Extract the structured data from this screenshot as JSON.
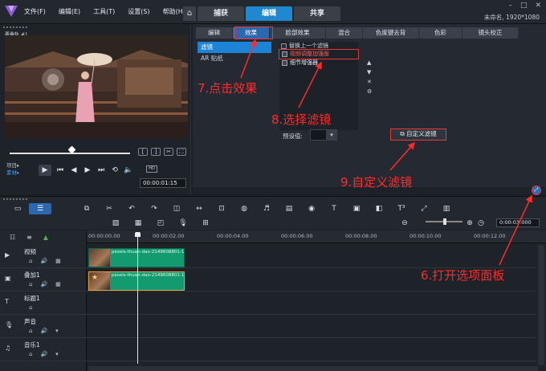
{
  "menu": {
    "items": [
      "文件(F)",
      "编辑(E)",
      "工具(T)",
      "设置(S)",
      "帮助(H)"
    ],
    "modes": [
      "捕获",
      "编辑",
      "共享"
    ],
    "active_mode": "编辑",
    "project_info": "未命名, 1920*1080"
  },
  "preview": {
    "clip_label": "覆叠轨 #1",
    "mode_project": "项目▸",
    "mode_clip": "素材▸",
    "timecode": "00:00:01:15"
  },
  "library": {
    "tabs": [
      "编辑",
      "效果",
      "脸部效果",
      "混合",
      "色度键去背",
      "色彩",
      "镜头校正"
    ],
    "active_tab": "效果",
    "categories": [
      "滤镜",
      "AR 贴纸"
    ],
    "active_category": "滤镜",
    "replace_last_filter": "替换上一个滤镜",
    "filters": [
      "视频调整加强版",
      "细节增强器"
    ],
    "selected_filter": "视频调整加强版",
    "preset_label": "预设值:",
    "custom_filter_button": "自定义滤镜"
  },
  "annotations": {
    "step6": "6.打开选项面板",
    "step7": "7.点击效果",
    "step8": "8.选择滤镜",
    "step9": "9.自定义滤镜"
  },
  "timeline": {
    "timecode": "0:00:03:000",
    "ruler": [
      "00:00:00.00",
      "00:00:02.00",
      "00:00:04.00",
      "00:00:06.00",
      "00:00:08.00",
      "00:00:10.00",
      "00:00:12.00"
    ],
    "tracks": [
      {
        "name": "视频"
      },
      {
        "name": "叠加1"
      },
      {
        "name": "标题1"
      },
      {
        "name": "声音"
      },
      {
        "name": "音乐1"
      }
    ],
    "clip_video": "pexels-thuan-dao-2149608801-1",
    "clip_overlay": "pexels-thuan-dao-2149608801-1"
  },
  "colors": {
    "accent": "#1e88d0",
    "annotation_red": "#ff2b2b",
    "clip_green": "#139a6e"
  }
}
